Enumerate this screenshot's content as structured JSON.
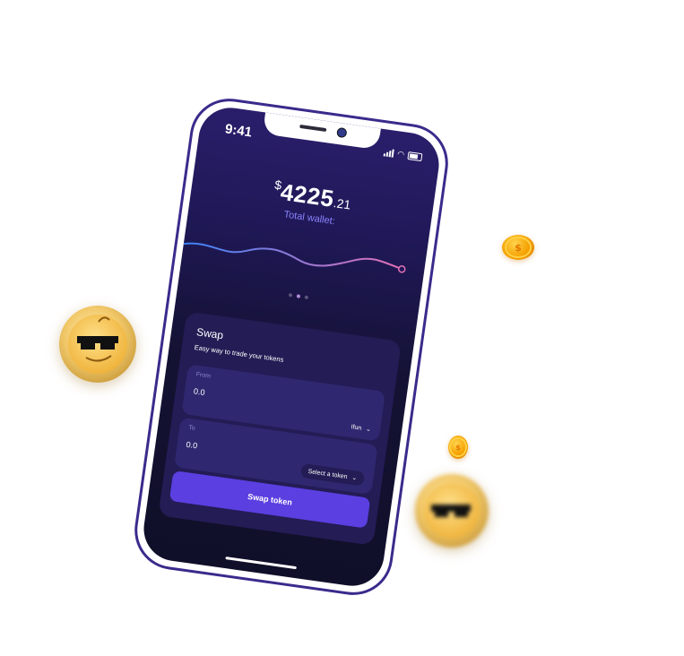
{
  "status_bar": {
    "time": "9:41"
  },
  "wallet": {
    "currency_symbol": "$",
    "amount_integer": "4225",
    "amount_decimal": ".21",
    "label": "Total wallet:"
  },
  "swap": {
    "title": "Swap",
    "subtitle": "Easy way to trade your tokens",
    "from": {
      "label": "From",
      "value": "0.0",
      "token": "Ifun"
    },
    "to": {
      "label": "To",
      "value": "0.0",
      "token_placeholder": "Select a token"
    },
    "direction_arrow": "↓",
    "button_label": "Swap token"
  },
  "carousel": {
    "page_count": 3,
    "active_page": 2
  },
  "icons": {
    "chevron": "chevron-down-icon",
    "signal": "signal-icon",
    "wifi": "wifi-icon",
    "battery": "battery-icon",
    "dollar_coin": "dollar-coin-icon",
    "mascot_coin": "mascot-coin-icon"
  },
  "colors": {
    "accent": "#5b3fe0",
    "frame": "#3b2a8c",
    "label_purple": "#8b82ff",
    "coin_gold": "#f5a100"
  }
}
